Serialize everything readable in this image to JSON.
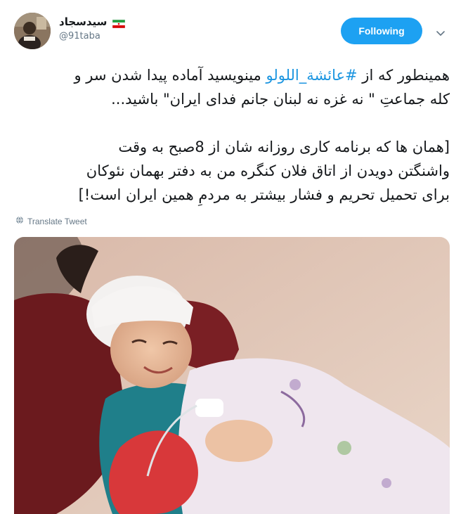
{
  "user": {
    "display_name": "سیدسجاد",
    "handle": "@91taba"
  },
  "follow_button": {
    "label": "Following"
  },
  "tweet": {
    "lines_part1": [
      {
        "before": "همینطور که از ",
        "hashtag": "#عائشة_اللولو",
        "after": " مینویسید آماده پیدا شدن سر و"
      },
      {
        "text": "کله جماعتِ \" نه غزه نه لبنان جانم فدای ایران\" باشید..."
      }
    ],
    "lines_part2": [
      "[همان ها که برنامه کاری روزانه شان از 8صبح به وقت",
      "واشنگتن دویدن از اتاق فلان کنگره من به دفتر بهمان نئوکان",
      "برای تحمیل تحریم و فشار بیشتر به مردمِ همین ایران است!]"
    ]
  },
  "translate_label": "Translate Tweet",
  "colors": {
    "accent": "#1da1f2",
    "hashtag": "#1b95e0",
    "muted": "#657786"
  },
  "icons": {
    "flag": "iran-flag-icon",
    "caret": "chevron-down-icon",
    "translate": "globe-icon"
  }
}
